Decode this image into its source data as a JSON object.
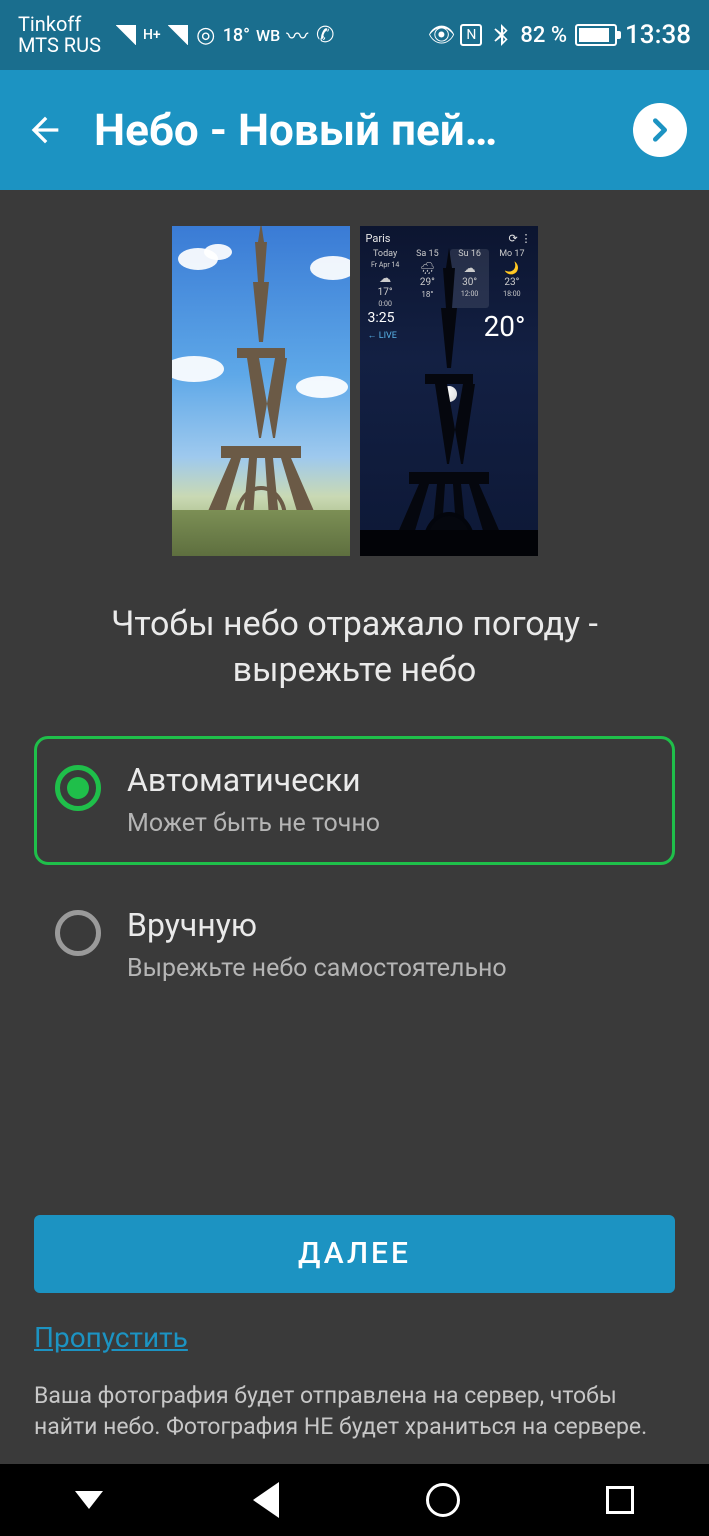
{
  "statusbar": {
    "carrier1": "Tinkoff",
    "carrier2": "MTS RUS",
    "signal_sup": "H+",
    "o2": "O²",
    "temp": "18°",
    "wb": "WB",
    "battery_pct": "82 %",
    "time": "13:38"
  },
  "appbar": {
    "title": "Небо - Новый пей…"
  },
  "preview_night": {
    "city": "Paris",
    "days": [
      {
        "label": "Today",
        "sub": "Fr Apr 14",
        "icon": "☁",
        "hi": "17°",
        "lo": "0:00"
      },
      {
        "label": "Sa 15",
        "sub": "",
        "icon": "🌧",
        "hi": "29°",
        "lo": "18°"
      },
      {
        "label": "Su 16",
        "sub": "",
        "icon": "☁",
        "hi": "30°",
        "lo": "12:00"
      },
      {
        "label": "Mo 17",
        "sub": "",
        "icon": "🌙",
        "hi": "23°",
        "lo": "18:00"
      }
    ],
    "clock": "3:25",
    "live": "← LIVE",
    "big_temp": "20°"
  },
  "heading": "Чтобы небо отражало погоду - вырежьте небо",
  "options": [
    {
      "primary": "Автоматически",
      "secondary": "Может быть не точно",
      "selected": true
    },
    {
      "primary": "Вручную",
      "secondary": "Вырежьте небо самостоятельно",
      "selected": false
    }
  ],
  "cta": "ДАЛЕЕ",
  "skip": "Пропустить",
  "disclaimer": "Ваша фотография будет отправлена на сервер, чтобы найти небо. Фотография НЕ будет храниться на сервере.",
  "colors": {
    "accent": "#1c93c2",
    "green": "#1fbf4a"
  }
}
